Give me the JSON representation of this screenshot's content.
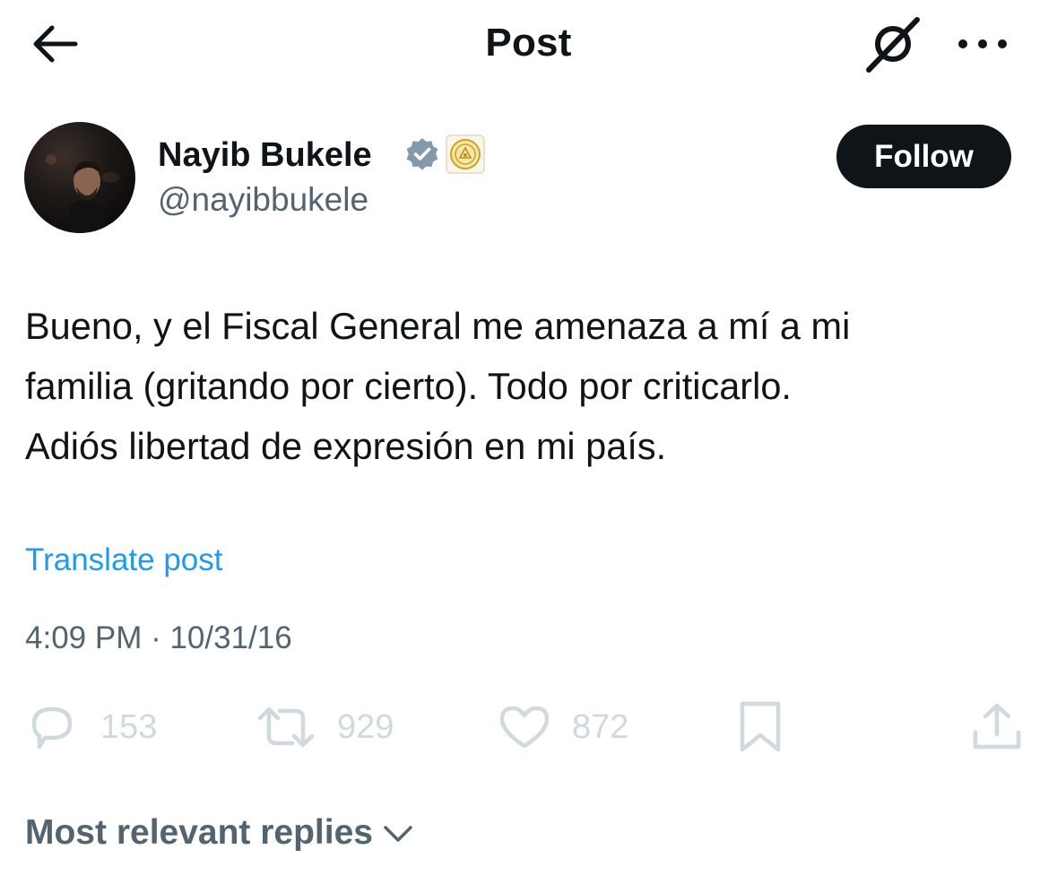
{
  "header": {
    "title": "Post",
    "back_icon": "arrow-left-icon",
    "grok_icon": "grok-icon",
    "more_icon": "more-dots-icon"
  },
  "author": {
    "name": "Nayib Bukele",
    "handle": "@nayibbukele",
    "verified_color": "#829aab",
    "affiliate_badge": "el-salvador-seal-icon"
  },
  "follow_button": {
    "label": "Follow"
  },
  "post": {
    "text": "Bueno, y el Fiscal General me amenaza a mí a mi\nfamilia (gritando por cierto). Todo por criticarlo.\nAdiós libertad de expresión en mi país.",
    "translate_label": "Translate post",
    "timestamp": "4:09 PM · 10/31/16"
  },
  "actions": {
    "replies": "153",
    "reposts": "929",
    "likes": "872",
    "reply_icon": "reply-icon",
    "repost_icon": "repost-icon",
    "like_icon": "heart-icon",
    "bookmark_icon": "bookmark-icon",
    "share_icon": "share-icon"
  },
  "replies_sort": {
    "label": "Most relevant replies"
  },
  "colors": {
    "text": "#0f1419",
    "secondary": "#536471",
    "link": "#1d9bf0",
    "muted_icon": "#cfd9de"
  }
}
